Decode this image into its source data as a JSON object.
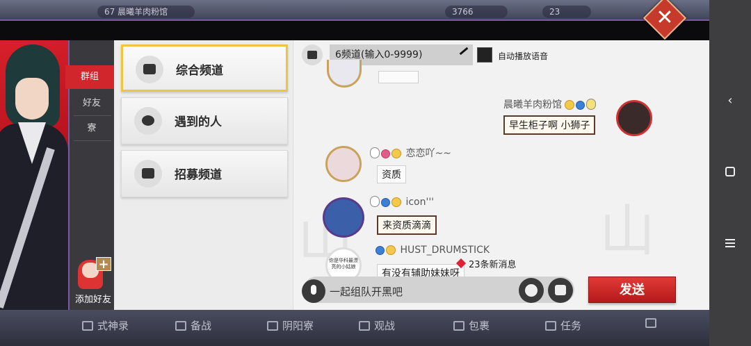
{
  "topbar": {
    "level": "67",
    "player_name": "晨曦羊肉粉馆",
    "currency1": "3766",
    "currency2": "23"
  },
  "sidenav": {
    "items": [
      {
        "label": "群组",
        "active": true
      },
      {
        "label": "好友",
        "active": false
      },
      {
        "label": "寮",
        "active": false
      }
    ],
    "add_friend_label": "添加好友"
  },
  "channels": [
    {
      "label": "综合频道",
      "icon": "chat-icon",
      "active": true
    },
    {
      "label": "遇到的人",
      "icon": "bomb-icon",
      "active": false
    },
    {
      "label": "招募频道",
      "icon": "plus-box-icon",
      "active": false
    }
  ],
  "chat_header": {
    "channel_selector": "6频道(输入0-9999)",
    "autoplay_label": "自动播放语音"
  },
  "messages": [
    {
      "user": "晨曦羊肉粉馆",
      "text": "早生柜子啊 小狮子",
      "side": "right"
    },
    {
      "user": "恋恋吖~~",
      "text": "资质",
      "side": "left"
    },
    {
      "user": "icon'''",
      "text": "来资质滴滴",
      "side": "left"
    },
    {
      "user": "HUST_DRUMSTICK",
      "text": "有没有辅助妹妹呀",
      "side": "left",
      "avatar_text": "你是华科最漂亮的小姑娘"
    }
  ],
  "new_messages": "23条新消息",
  "input": {
    "value": "一起组队开黑吧"
  },
  "send_label": "发送",
  "bottom_tabs": [
    "式神录",
    "备战",
    "阴阳寮",
    "观战",
    "包裹",
    "任务"
  ],
  "colors": {
    "accent_red": "#d0262c",
    "active_border": "#f0c53d",
    "panel_bg": "#efefef"
  }
}
